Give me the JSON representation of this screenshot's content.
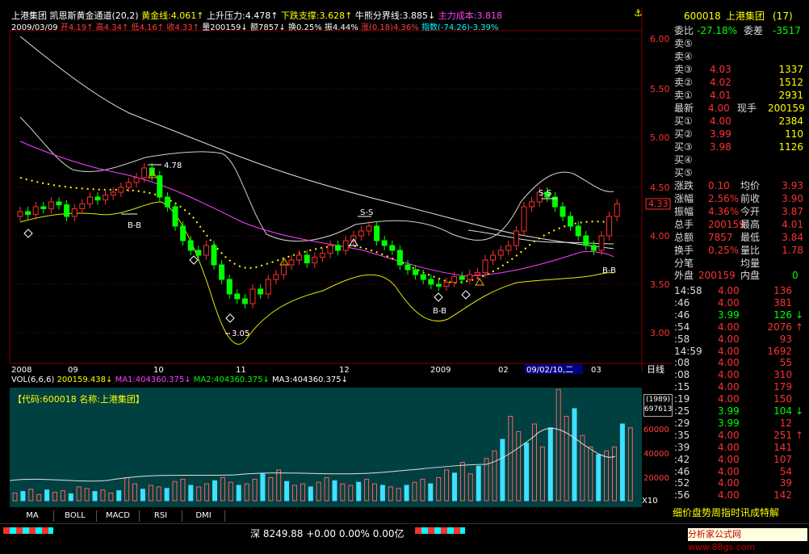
{
  "header": {
    "name": "上港集团",
    "indicator": "凯恩斯黄金通道(20,2)",
    "gold_line": "黄金线:4.061",
    "resistance": "上升压力:4.478",
    "support": "下跌支撑:3.628",
    "bull_bear": "牛熊分界线:3.885",
    "main_cost": "主力成本:3.818",
    "date": "2009/03/09",
    "open": "开4.19",
    "high": "高4.34",
    "low": "低4.16",
    "close": "收4.33",
    "volume": "量200159",
    "amount": "额7857",
    "turnover": "换0.25%",
    "amplitude": "振4.44%",
    "change": "涨(0.18)4.36%",
    "index": "指数(-74.26)-3.39%"
  },
  "price_axis": {
    "ticks": [
      "6.00",
      "5.50",
      "5.00",
      "4.50",
      "4.00",
      "3.50",
      "3.00"
    ],
    "current_tag": "4.33"
  },
  "annotations": {
    "high_label": "4.78",
    "low_label": "3.05",
    "ss1": "S-S",
    "ss2": "S-S",
    "bb1": "B-B",
    "bb2": "B-B",
    "bb3": "B-B"
  },
  "date_axis": {
    "labels": [
      "2008",
      "09",
      "10",
      "11",
      "12",
      "2009",
      "02",
      "09/02/10,二",
      "03"
    ],
    "period": "日线"
  },
  "volume": {
    "header_vol": "VOL(6,6,6)",
    "vol_value": "200159.438",
    "ma1": "MA1:404360.375",
    "ma2": "MA2:404360.375",
    "ma3": "MA3:404360.375",
    "code_label": "【代码:600018 名称:上港集团】",
    "side_box1": "(1989)",
    "side_box2": "697613",
    "ticks": [
      "60000",
      "40000",
      "20000"
    ],
    "unit": "X10"
  },
  "tabs": [
    "MA",
    "BOLL",
    "MACD",
    "RSI",
    "DMI"
  ],
  "quote": {
    "code": "600018",
    "name": "上港集团",
    "seq": "(17)",
    "weibi_label": "委比",
    "weibi": "-27.18%",
    "weicha_label": "委差",
    "weicha": "-3517",
    "asks": [
      {
        "label": "卖⑤",
        "price": "",
        "vol": ""
      },
      {
        "label": "卖④",
        "price": "",
        "vol": ""
      },
      {
        "label": "卖③",
        "price": "4.03",
        "vol": "1337"
      },
      {
        "label": "卖②",
        "price": "4.02",
        "vol": "1512"
      },
      {
        "label": "卖①",
        "price": "4.01",
        "vol": "2931"
      }
    ],
    "latest_label": "最新",
    "latest": "4.00",
    "now_hand_label": "现手",
    "now_hand": "200159",
    "bids": [
      {
        "label": "买①",
        "price": "4.00",
        "vol": "2384"
      },
      {
        "label": "买②",
        "price": "3.99",
        "vol": "110"
      },
      {
        "label": "买③",
        "price": "3.98",
        "vol": "1126"
      },
      {
        "label": "买④",
        "price": "",
        "vol": ""
      },
      {
        "label": "买⑤",
        "price": "",
        "vol": ""
      }
    ],
    "stats": [
      [
        "涨跌",
        "0.10",
        "均价",
        "3.93"
      ],
      [
        "涨幅",
        "2.56%",
        "前收",
        "3.90"
      ],
      [
        "振幅",
        "4.36%",
        "今开",
        "3.87"
      ],
      [
        "总手",
        "200159",
        "最高",
        "4.01"
      ],
      [
        "总额",
        "7857",
        "最低",
        "3.84"
      ],
      [
        "换手",
        "0.25%",
        "量比",
        "1.78"
      ],
      [
        "分笔",
        "",
        "均量",
        ""
      ]
    ],
    "outer_label": "外盘",
    "outer": "200159",
    "inner_label": "内盘",
    "inner": "0",
    "ticks": [
      [
        "14:58",
        "4.00",
        "136",
        ""
      ],
      [
        ":46",
        "4.00",
        "381",
        ""
      ],
      [
        ":46",
        "3.99",
        "126",
        "↓"
      ],
      [
        ":54",
        "4.00",
        "2076",
        "↑"
      ],
      [
        ":58",
        "4.00",
        "93",
        ""
      ],
      [
        "14:59",
        "4.00",
        "1692",
        ""
      ],
      [
        ":08",
        "4.00",
        "55",
        ""
      ],
      [
        ":08",
        "4.00",
        "310",
        ""
      ],
      [
        ":15",
        "4.00",
        "179",
        ""
      ],
      [
        ":19",
        "4.00",
        "150",
        ""
      ],
      [
        ":25",
        "3.99",
        "104",
        "↓"
      ],
      [
        ":29",
        "3.99",
        "12",
        ""
      ],
      [
        ":35",
        "4.00",
        "251",
        "↑"
      ],
      [
        ":39",
        "4.00",
        "141",
        ""
      ],
      [
        ":42",
        "4.00",
        "107",
        ""
      ],
      [
        ":46",
        "4.00",
        "54",
        ""
      ],
      [
        ":52",
        "4.00",
        "39",
        ""
      ],
      [
        ":56",
        "4.00",
        "142",
        ""
      ]
    ],
    "bottom_tabs": "细价盘势周指时讯成特解"
  },
  "status": {
    "market": "深 8249.88 +0.00 0.00% 0.00亿",
    "site": "分析家公式网www.88gs.com"
  },
  "colors": {
    "up": "#ff3030",
    "down": "#00ff00",
    "ma": "#ff40ff",
    "upper": "#e0e0e0",
    "lower": "#ffff00",
    "bg": "#000000",
    "vol_bg": "#004040"
  }
}
